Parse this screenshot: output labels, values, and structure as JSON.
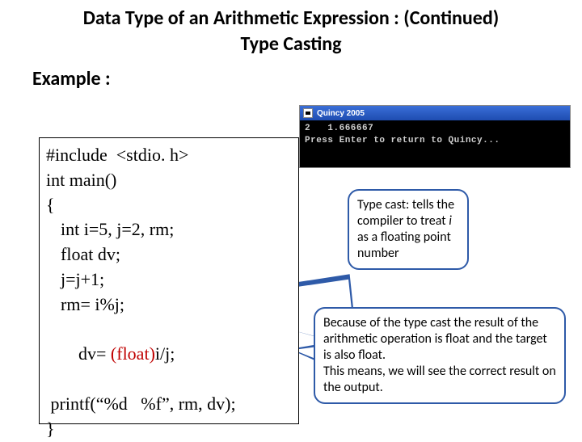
{
  "title_line1": "Data Type of an Arithmetic Expression : (Continued)",
  "title_line2": "Type Casting",
  "example_label": "Example :",
  "code": {
    "l1": "#include  <stdio. h>",
    "l2": "int main()",
    "l3": "{",
    "l4": "int i=5, j=2, rm;",
    "l5": "float dv;",
    "l6": "j=j+1;",
    "l7": "rm= i%j;",
    "l8a": "dv= ",
    "l8b": "(float)",
    "l8c": "i/j;",
    "l9": " printf(“%d   %f”, rm, dv);",
    "l10": "}"
  },
  "terminal": {
    "title": "Quincy 2005",
    "line1": "2   1.666667",
    "line2": "Press Enter to return to Quincy..."
  },
  "callout1": {
    "pre": "Type cast: tells the compiler to treat ",
    "ital": "i",
    "post": " as a floating point number"
  },
  "callout2": "Because of the type cast the result of the arithmetic operation is  float and the target is also float.\nThis means, we will see the correct result on the output."
}
